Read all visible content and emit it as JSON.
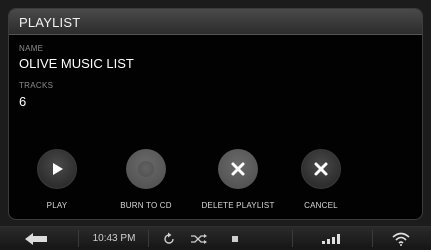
{
  "header": {
    "title": "PLAYLIST"
  },
  "fields": {
    "name_label": "NAME",
    "name_value": "OLIVE MUSIC LIST",
    "tracks_label": "TRACKS",
    "tracks_value": "6"
  },
  "actions": [
    {
      "label": "PLAY",
      "icon": "play-icon"
    },
    {
      "label": "BURN TO CD",
      "icon": "disc-icon"
    },
    {
      "label": "DELETE PLAYLIST",
      "icon": "x-icon"
    },
    {
      "label": "CANCEL",
      "icon": "x-icon"
    }
  ],
  "statusbar": {
    "time": "10:43 PM",
    "icons": [
      "back-arrow-icon",
      "repeat-icon",
      "shuffle-icon",
      "stop-icon",
      "signal-bars-icon",
      "wifi-icon"
    ]
  },
  "colors": {
    "panel_bg": "#020202",
    "header_bg": "#3a3a3a",
    "text": "#ffffff",
    "label": "#8c8c8c"
  }
}
